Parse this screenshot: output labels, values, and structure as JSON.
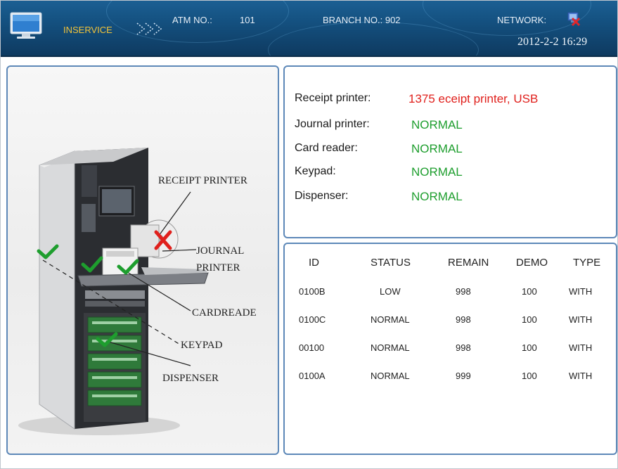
{
  "header": {
    "status": "INSERVICE",
    "atm_no_label": "ATM NO.:",
    "atm_no_value": "101",
    "branch_no_label": "BRANCH NO.: 902",
    "network_label": "NETWORK:",
    "datetime": "2012-2-2  16:29"
  },
  "colors": {
    "header_bg": "#14507f",
    "status": "#f2c33a",
    "ok": "#1e9e2e",
    "error": "#e0201c",
    "panel_border": "#5d88b8"
  },
  "diagram": {
    "callouts": {
      "receipt_printer": "RECEIPT PRINTER",
      "journal_printer_1": "JOURNAL",
      "journal_printer_2": "PRINTER",
      "card_reader": "CARDREADE",
      "keypad": "KEYPAD",
      "dispenser": "DISPENSER"
    }
  },
  "devices": [
    {
      "label": "Receipt printer:",
      "value": "1375 eceipt printer, USB",
      "state": "error"
    },
    {
      "label": "Journal printer:",
      "value": "NORMAL",
      "state": "ok"
    },
    {
      "label": "Card reader:",
      "value": "NORMAL",
      "state": "ok"
    },
    {
      "label": "Keypad:",
      "value": "NORMAL",
      "state": "ok"
    },
    {
      "label": "Dispenser:",
      "value": "NORMAL",
      "state": "ok"
    }
  ],
  "cassettes": {
    "headers": {
      "id": "ID",
      "status": "STATUS",
      "remain": "REMAIN",
      "demo": "DEMO",
      "type": "TYPE"
    },
    "rows": [
      {
        "id": "0100B",
        "status": "LOW",
        "remain": "998",
        "demo": "100",
        "type": "WITH"
      },
      {
        "id": "0100C",
        "status": "NORMAL",
        "remain": "998",
        "demo": "100",
        "type": "WITH"
      },
      {
        "id": "00100",
        "status": "NORMAL",
        "remain": "998",
        "demo": "100",
        "type": "WITH"
      },
      {
        "id": "0100A",
        "status": "NORMAL",
        "remain": "999",
        "demo": "100",
        "type": "WITH"
      }
    ]
  }
}
